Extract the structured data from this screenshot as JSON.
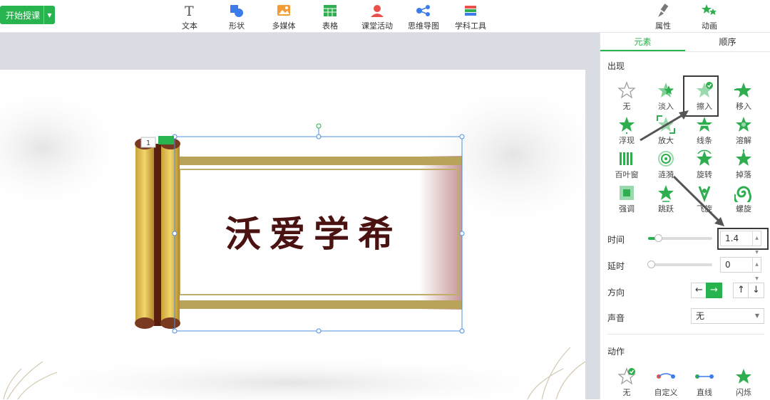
{
  "toolbar": {
    "start_label": "开始授课",
    "tools": [
      {
        "label": "文本",
        "icon": "text-icon"
      },
      {
        "label": "形状",
        "icon": "shape-icon"
      },
      {
        "label": "多媒体",
        "icon": "media-icon"
      },
      {
        "label": "表格",
        "icon": "table-icon"
      },
      {
        "label": "课堂活动",
        "icon": "activity-icon"
      },
      {
        "label": "思维导图",
        "icon": "mindmap-icon"
      },
      {
        "label": "学科工具",
        "icon": "subject-tools-icon"
      }
    ],
    "right_tools": [
      {
        "label": "属性",
        "icon": "brush-icon"
      },
      {
        "label": "动画",
        "icon": "animation-icon"
      }
    ]
  },
  "slide": {
    "title_text": "沃爱学希",
    "order_badge": "1"
  },
  "panel": {
    "tabs": [
      "元素",
      "顺序"
    ],
    "appear_title": "出现",
    "appear_items": [
      "无",
      "淡入",
      "擦入",
      "移入",
      "浮现",
      "放大",
      "线条",
      "溶解",
      "百叶窗",
      "涟漪",
      "旋转",
      "掉落",
      "强调",
      "跳跃",
      "飞旋",
      "螺旋"
    ],
    "selected_item": "擦入",
    "time_label": "时间",
    "time_value": "1.4",
    "time_fraction": 0.16,
    "delay_label": "延时",
    "delay_value": "0",
    "delay_fraction": 0,
    "direction_label": "方向",
    "directions": [
      "←",
      "→",
      "↑",
      "↓"
    ],
    "sound_label": "声音",
    "sound_value": "无",
    "action_title": "动作",
    "action_items": [
      "无",
      "自定义",
      "直线",
      "闪烁"
    ],
    "accent": "#27b34d"
  }
}
